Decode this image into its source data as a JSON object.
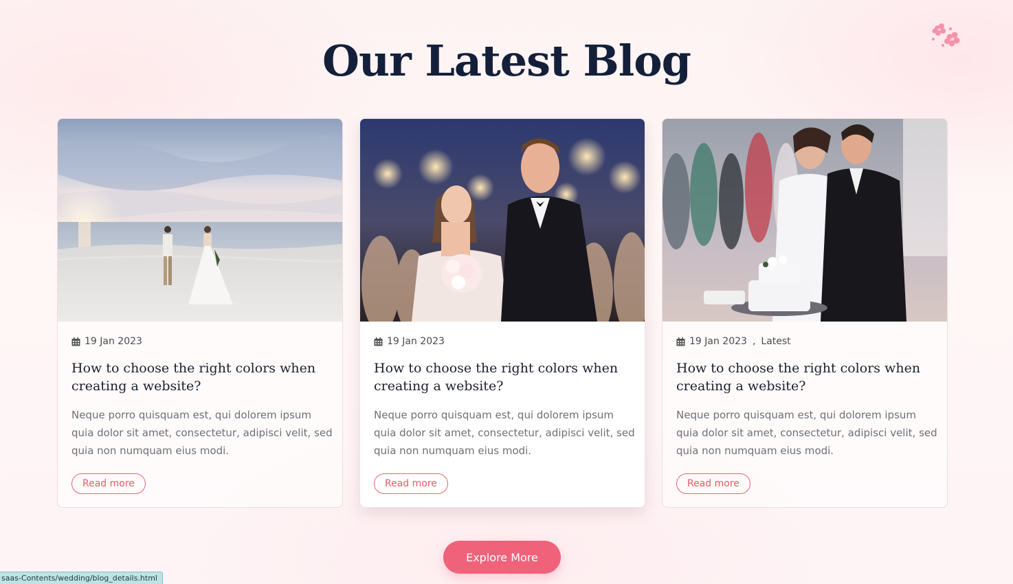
{
  "section": {
    "title": "Our Latest Blog"
  },
  "cards": [
    {
      "date": "19 Jan 2023",
      "category": "",
      "title": "How to choose the right colors when creating a website?",
      "excerpt": "Neque porro quisquam est, qui dolorem ipsum quia dolor sit amet, consectetur, adipisci velit, sed quia non numquam eius modi.",
      "button": "Read more",
      "image": "beach-couple-sunset-photo"
    },
    {
      "date": "19 Jan 2023",
      "category": "",
      "title": "How to choose the right colors when creating a website?",
      "excerpt": "Neque porro quisquam est, qui dolorem ipsum quia dolor sit amet, consectetur, adipisci velit, sed quia non numquam eius modi.",
      "button": "Read more",
      "image": "sparkler-couple-night-photo"
    },
    {
      "date": "19 Jan 2023",
      "separator": ",",
      "category": "Latest",
      "title": "How to choose the right colors when creating a website?",
      "excerpt": "Neque porro quisquam est, qui dolorem ipsum quia dolor sit amet, consectetur, adipisci velit, sed quia non numquam eius modi.",
      "button": "Read more",
      "image": "cake-cutting-couple-photo"
    }
  ],
  "explore_button": "Explore More",
  "status_bar": {
    "url": "saas-Contents/wedding/blog_details.html"
  },
  "colors": {
    "accent": "#f0627a",
    "outline": "#e8646e",
    "title": "#14203a"
  },
  "icons": {
    "date": "calendar-icon",
    "decoration": "flower-icon"
  }
}
